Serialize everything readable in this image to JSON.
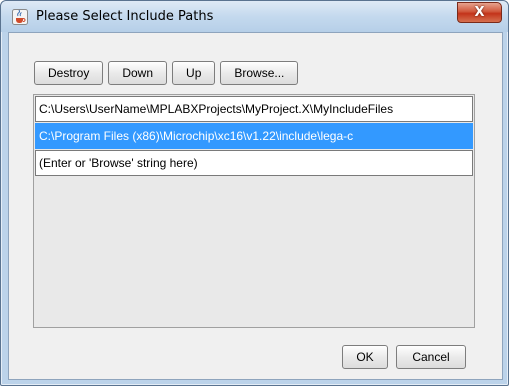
{
  "window": {
    "title": "Please Select Include Paths",
    "close_label": "X",
    "icon": "java-cup-icon"
  },
  "toolbar": {
    "destroy_label": "Destroy",
    "down_label": "Down",
    "up_label": "Up",
    "browse_label": "Browse..."
  },
  "paths": {
    "items": [
      "C:\\Users\\UserName\\MPLABXProjects\\MyProject.X\\MyIncludeFiles",
      "C:\\Program Files (x86)\\Microchip\\xc16\\v1.22\\include\\lega-c",
      "(Enter or 'Browse' string here)"
    ],
    "selected_index": 1
  },
  "footer": {
    "ok_label": "OK",
    "cancel_label": "Cancel"
  },
  "colors": {
    "selection": "#3399ff",
    "dialog_bg": "#f0f0f0",
    "titlebar": "#c4d9ee"
  }
}
